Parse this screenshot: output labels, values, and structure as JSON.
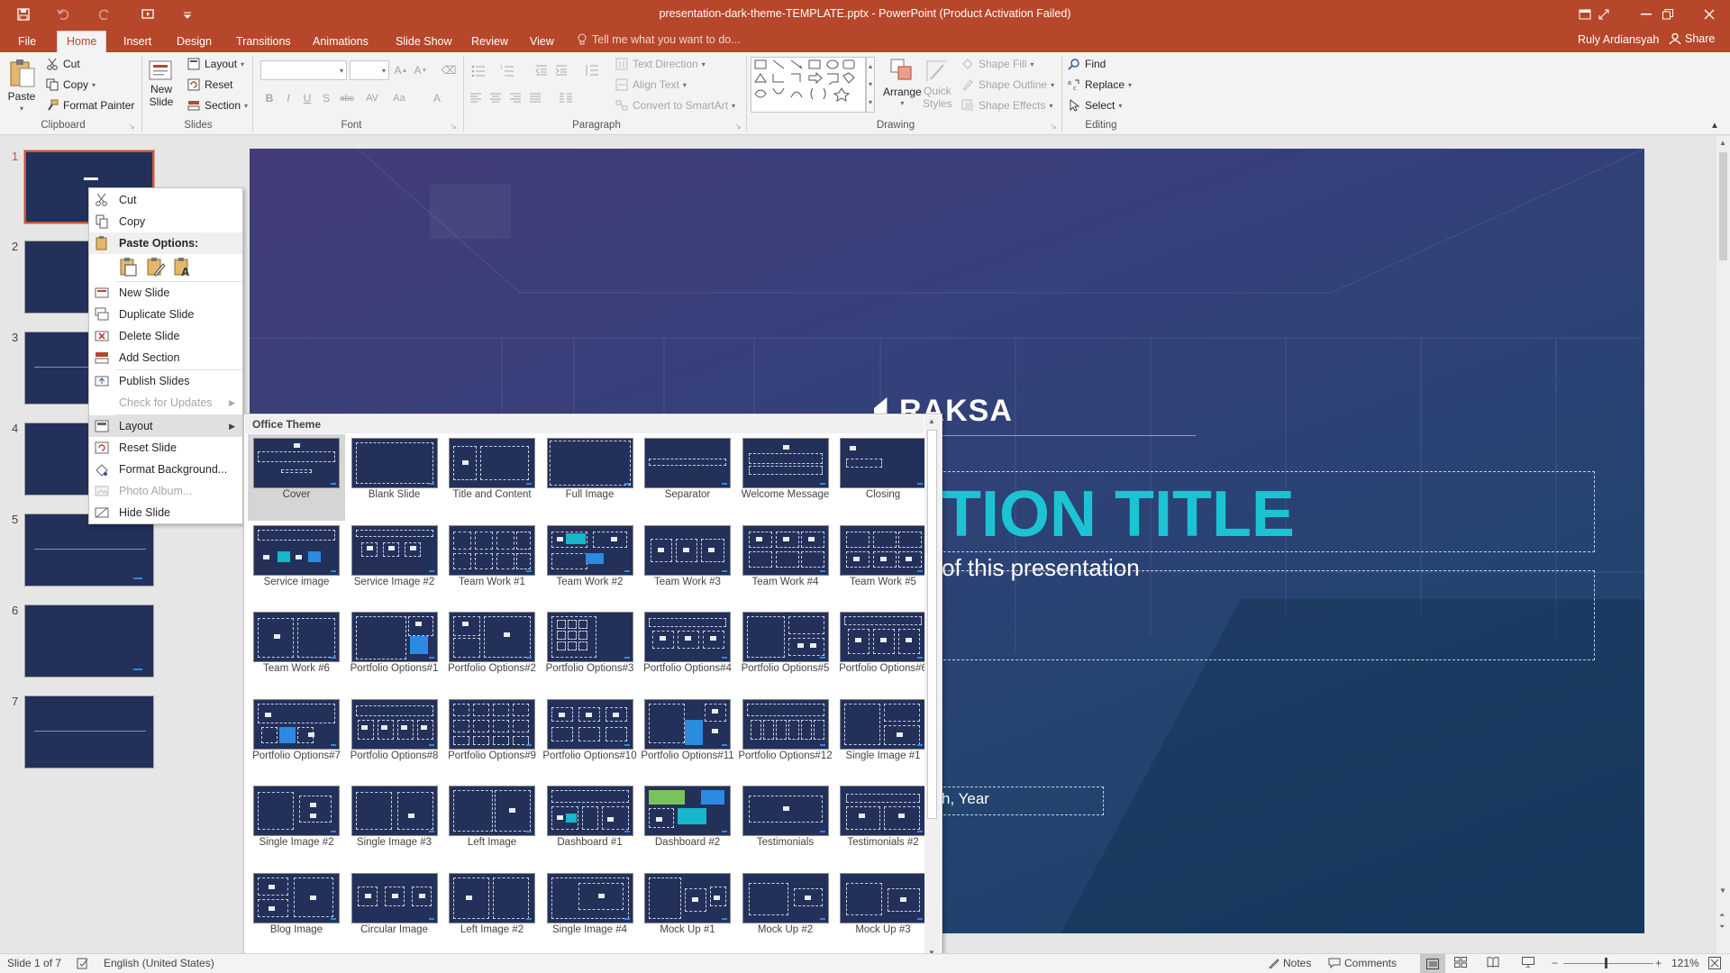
{
  "window": {
    "title": "presentation-dark-theme-TEMPLATE.pptx - PowerPoint (Product Activation Failed)"
  },
  "ribbon_tabs": [
    "File",
    "Home",
    "Insert",
    "Design",
    "Transitions",
    "Animations",
    "Slide Show",
    "Review",
    "View"
  ],
  "tell_me": "Tell me what you want to do...",
  "user": {
    "name": "Ruly Ardiansyah",
    "share": "Share"
  },
  "clipboard": {
    "paste": "Paste",
    "cut": "Cut",
    "copy": "Copy",
    "format_painter": "Format Painter",
    "label": "Clipboard"
  },
  "slides_group": {
    "new_slide_1": "New",
    "new_slide_2": "Slide",
    "layout": "Layout",
    "reset": "Reset",
    "section": "Section",
    "label": "Slides"
  },
  "font_group": {
    "label": "Font",
    "bold": "B",
    "italic": "I",
    "underline": "U",
    "strike": "S",
    "shadow": "abc",
    "spacing": "AV",
    "case": "Aa",
    "color": "A"
  },
  "paragraph_group": {
    "label": "Paragraph",
    "text_direction": "Text Direction",
    "align_text": "Align Text",
    "convert_smartart": "Convert to SmartArt"
  },
  "drawing_group": {
    "label": "Drawing",
    "arrange": "Arrange",
    "quick_styles_1": "Quick",
    "quick_styles_2": "Styles",
    "shape_fill": "Shape Fill",
    "shape_outline": "Shape Outline",
    "shape_effects": "Shape Effects"
  },
  "editing_group": {
    "label": "Editing",
    "find": "Find",
    "replace": "Replace",
    "select": "Select"
  },
  "slide_numbers": [
    "1",
    "2",
    "3",
    "4",
    "5",
    "6",
    "7"
  ],
  "slide": {
    "logo": "RAKSA",
    "title_visible": "TION TITLE",
    "subtitle_visible": "of this presentation",
    "date_visible": "h, Year"
  },
  "context_menu": {
    "cut": "Cut",
    "copy": "Copy",
    "paste_options": "Paste Options:",
    "new_slide": "New Slide",
    "duplicate_slide": "Duplicate Slide",
    "delete_slide": "Delete Slide",
    "add_section": "Add Section",
    "publish_slides": "Publish Slides",
    "check_updates": "Check for Updates",
    "layout": "Layout",
    "reset_slide": "Reset Slide",
    "format_background": "Format Background...",
    "photo_album": "Photo Album...",
    "hide_slide": "Hide Slide"
  },
  "gallery": {
    "header": "Office Theme",
    "layouts": [
      {
        "name": "Cover"
      },
      {
        "name": "Blank Slide"
      },
      {
        "name": "Title and Content"
      },
      {
        "name": "Full Image"
      },
      {
        "name": "Separator"
      },
      {
        "name": "Welcome Message"
      },
      {
        "name": "Closing"
      },
      {
        "name": "Service image"
      },
      {
        "name": "Service Image #2"
      },
      {
        "name": "Team Work #1"
      },
      {
        "name": "Team Work #2"
      },
      {
        "name": "Team Work #3"
      },
      {
        "name": "Team Work #4"
      },
      {
        "name": "Team Work #5"
      },
      {
        "name": "Team Work #6"
      },
      {
        "name": "Portfolio Options#1"
      },
      {
        "name": "Portfolio Options#2"
      },
      {
        "name": "Portfolio Options#3"
      },
      {
        "name": "Portfolio Options#4"
      },
      {
        "name": "Portfolio Options#5"
      },
      {
        "name": "Portfolio Options#6"
      },
      {
        "name": "Portfolio Options#7"
      },
      {
        "name": "Portfolio Options#8"
      },
      {
        "name": "Portfolio Options#9"
      },
      {
        "name": "Portfolio Options#10"
      },
      {
        "name": "Portfolio Options#11"
      },
      {
        "name": "Portfolio Options#12"
      },
      {
        "name": "Single Image #1"
      },
      {
        "name": "Single Image #2"
      },
      {
        "name": "Single Image #3"
      },
      {
        "name": "Left Image"
      },
      {
        "name": "Dashboard #1"
      },
      {
        "name": "Dashboard #2"
      },
      {
        "name": "Testimonials"
      },
      {
        "name": "Testimonials #2"
      },
      {
        "name": "Blog Image"
      },
      {
        "name": "Circular Image"
      },
      {
        "name": "Left Image #2"
      },
      {
        "name": "Single Image #4"
      },
      {
        "name": "Mock Up #1"
      },
      {
        "name": "Mock Up #2"
      },
      {
        "name": "Mock Up #3"
      }
    ]
  },
  "status": {
    "slide_of": "Slide 1 of 7",
    "language": "English (United States)",
    "notes": "Notes",
    "comments": "Comments",
    "zoom": "121%"
  }
}
